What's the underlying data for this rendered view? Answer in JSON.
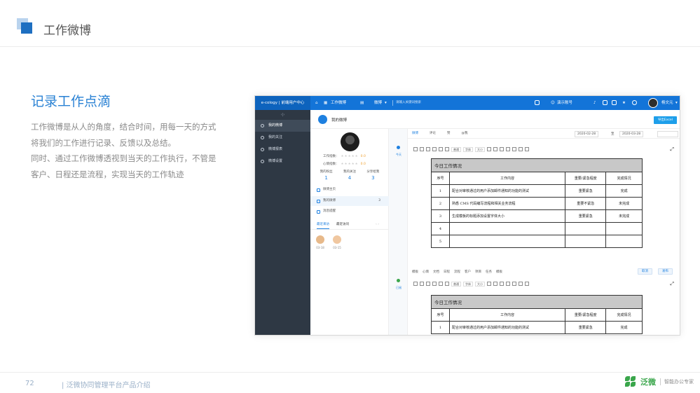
{
  "slide": {
    "header_title": "工作微博",
    "section_title": "记录工作点滴",
    "body_lines": [
      "工作微博是从人的角度，结合时间，用每一天的方式",
      "将我们的工作进行记录、反馈以及总结。",
      "同时、通过工作微博透视到当天的工作执行，不管是",
      "客户、日程还是流程，实现当天的工作轨迹"
    ],
    "page_number": "72",
    "footer_text": "| 泛微协同管理平台产品介绍",
    "footer_brand": "泛微",
    "footer_brand_sub": "智能办公专家"
  },
  "app": {
    "brand": "e-cology | 前端用户中心",
    "module": "工作微博",
    "search_scope": "微博",
    "search_placeholder": "请输入关键词搜索",
    "account_label": "演示账号",
    "user_name": "杨文元",
    "sidebar": {
      "collapse_glyph": "‹|›",
      "items": [
        {
          "label": "我的微博"
        },
        {
          "label": "我的关注"
        },
        {
          "label": "微博报表"
        },
        {
          "label": "微博设置"
        }
      ]
    },
    "subheader": {
      "title": "我的微博",
      "export_button": "导出Excel"
    },
    "profile": {
      "work_index_label": "工作指数：",
      "work_index_value": "0.0",
      "mood_index_label": "心情指数：",
      "mood_index_value": "0.0",
      "stats": [
        {
          "label": "我的粉丝",
          "value": "1"
        },
        {
          "label": "我的关注",
          "value": "4"
        },
        {
          "label": "分享给我",
          "value": "3"
        }
      ],
      "links": [
        {
          "label": "微博主页",
          "count": ""
        },
        {
          "label": "我的微博",
          "count": "3"
        },
        {
          "label": "消息提醒",
          "count": ""
        }
      ],
      "tabs": [
        "最近来访",
        "最近访问"
      ],
      "visitors": [
        {
          "date": "03-18"
        },
        {
          "date": "03-15"
        }
      ]
    },
    "timeline": {
      "today": "今天",
      "read": "已阅"
    },
    "feed": {
      "tabs": [
        "微博",
        "评论",
        "赞",
        "@我"
      ],
      "date_from": "2020-02-28",
      "date_sep": "至",
      "date_to": "2020-03-28",
      "font_family_dd": "字体",
      "font_size_dd": "大小",
      "paragraph_dd": "普通",
      "toolbar_actions": [
        "模板",
        "心情",
        "文档",
        "日程",
        "流程",
        "客户",
        "项目",
        "任务",
        "模板"
      ],
      "cancel_btn": "取消",
      "submit_btn": "发布",
      "table": {
        "caption": "今日工作情况",
        "headers": [
          "序号",
          "工作内容",
          "重要/紧急程度",
          "完成情况"
        ],
        "rows": [
          [
            "1",
            "配合对审核通过的用户添加邮件通知的功能的测试",
            "重要紧急",
            "完成"
          ],
          [
            "2",
            "熟悉 CMS 代码编写流程和相关业务流程",
            "重要不紧急",
            "未完成"
          ],
          [
            "3",
            "生成模板的标题添加设置字体大小",
            "重要紧急",
            "未完成"
          ],
          [
            "4",
            "",
            "",
            ""
          ],
          [
            "5",
            "",
            "",
            ""
          ]
        ],
        "rows_second": [
          [
            "1",
            "配合对审核通过的用户添加邮件通知的功能的测试",
            "重要紧急",
            "完成"
          ]
        ]
      }
    }
  }
}
